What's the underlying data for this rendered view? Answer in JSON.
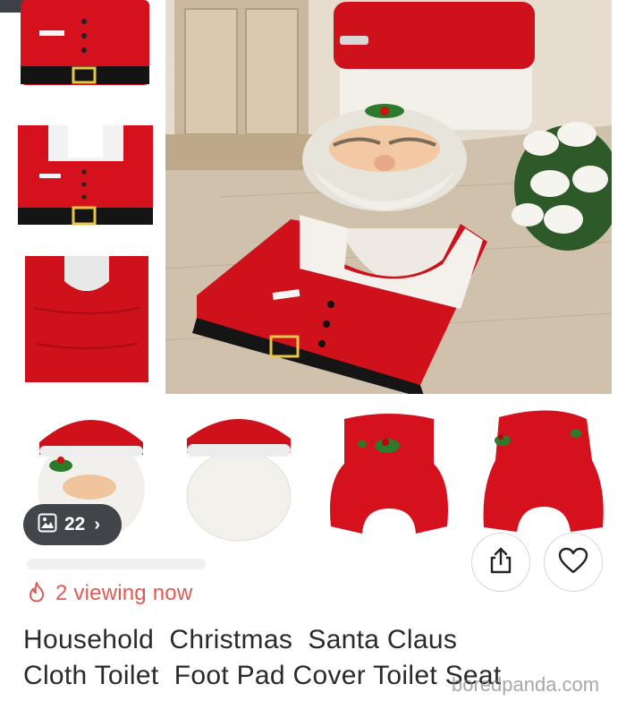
{
  "gallery": {
    "count": "22",
    "chevron": "›"
  },
  "viewing": {
    "text": "2 viewing now"
  },
  "product": {
    "title_line1": "Household  Christmas  Santa Claus",
    "title_line2": "Cloth Toilet  Foot Pad Cover Toilet Seat"
  },
  "watermark": "boredpanda.com",
  "colors": {
    "santa_red": "#d4111d",
    "viewing_accent": "#e05a52",
    "pill_bg": "#2c3036"
  },
  "icons": {
    "gallery": "image-icon",
    "share": "share-icon",
    "favorite": "heart-icon",
    "viewing": "flame-icon"
  }
}
